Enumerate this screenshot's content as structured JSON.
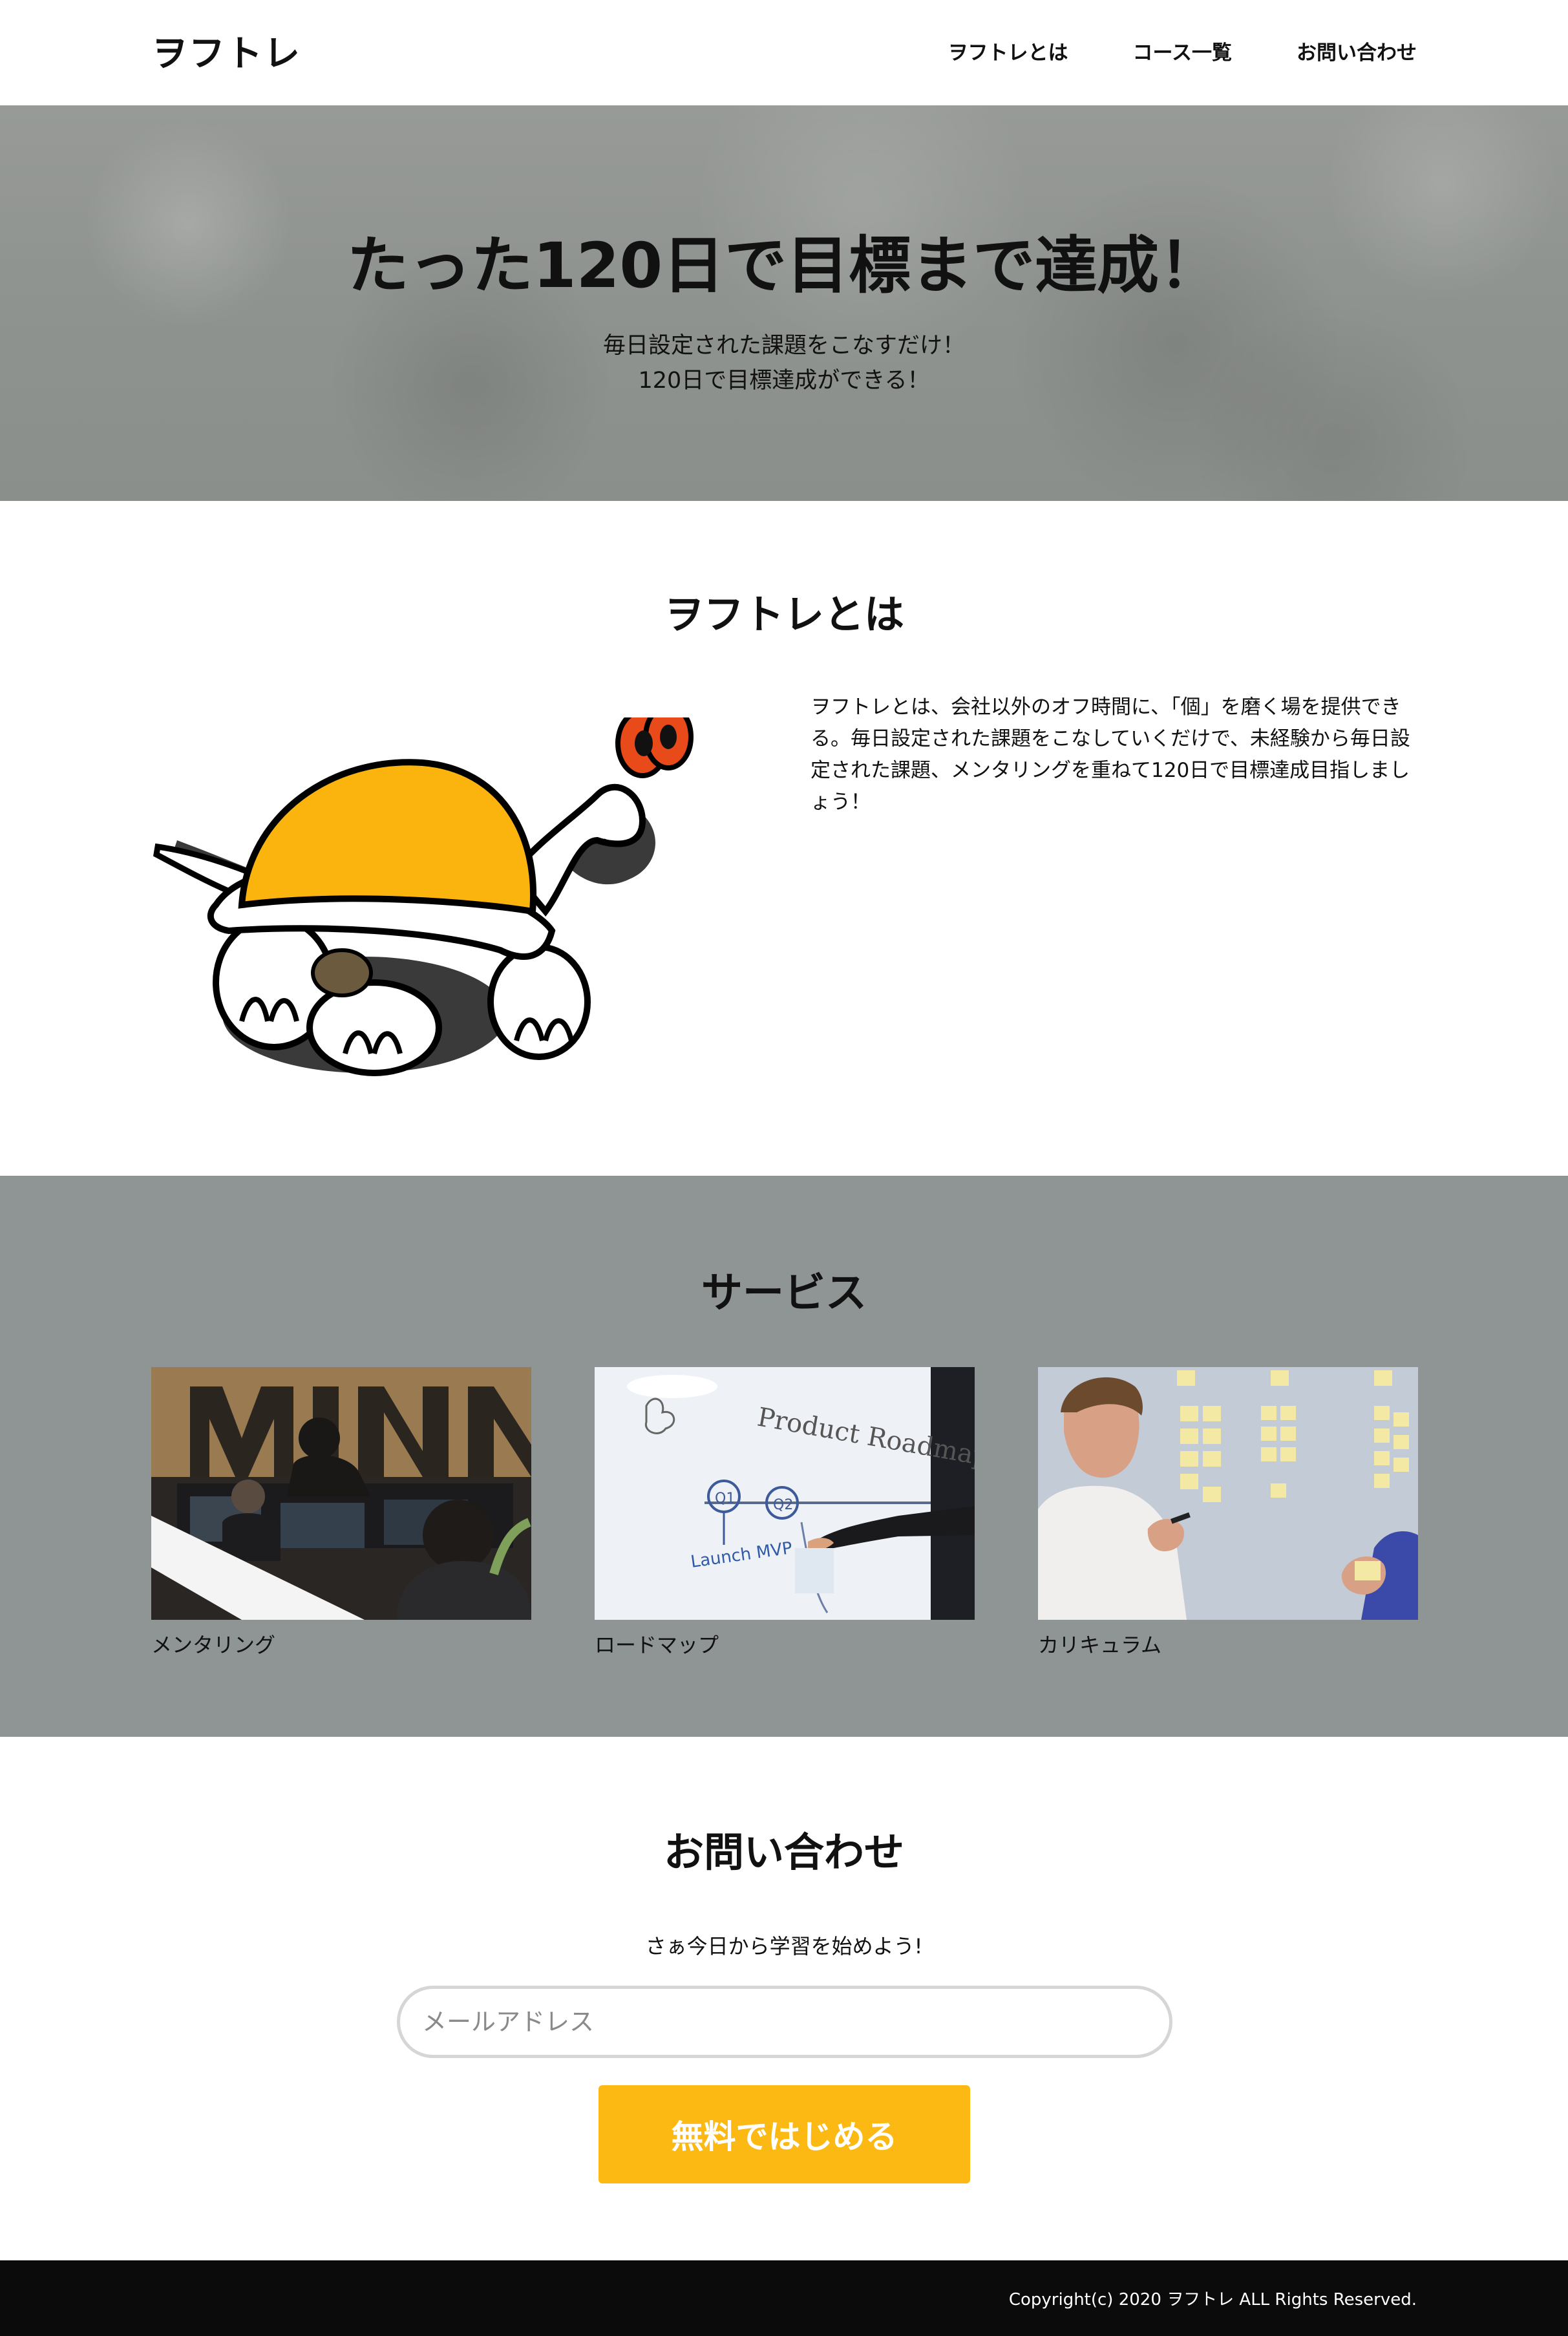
{
  "header": {
    "logo": "ヲフトレ",
    "nav": [
      "ヲフトレとは",
      "コース一覧",
      "お問い合わせ"
    ]
  },
  "hero": {
    "title": "たった120日で目標まで達成！",
    "subtitle_line1": "毎日設定された課題をこなすだけ！",
    "subtitle_line2": "120日で目標達成ができる！"
  },
  "about": {
    "title": "ヲフトレとは",
    "text": "ヲフトレとは、会社以外のオフ時間に、「個」を磨く場を提供できる。毎日設定された課題をこなしていくだけで、未経験から毎日設定された課題、メンタリングを重ねて120日で目標達成目指しましょう！",
    "image_icon": "turtle-illustration"
  },
  "services": {
    "title": "サービス",
    "items": [
      {
        "caption": "メンタリング",
        "image": "mentoring-photo"
      },
      {
        "caption": "ロードマップ",
        "image": "whiteboard-roadmap-photo"
      },
      {
        "caption": "カリキュラム",
        "image": "sticky-notes-curriculum-photo"
      }
    ],
    "whiteboard_heading": "Product Roadmap",
    "whiteboard_q": [
      "Q1",
      "Q2"
    ],
    "whiteboard_note": "Launch MVP"
  },
  "contact": {
    "title": "お問い合わせ",
    "lead": "さぁ今日から学習を始めよう!",
    "email_placeholder": "メールアドレス",
    "email_value": "",
    "cta_label": "無料ではじめる"
  },
  "footer": {
    "copyright": "Copyright(c) 2020 ヲフトレ ALL Rights Reserved."
  },
  "colors": {
    "accent": "#fdb913",
    "services_bg": "#8f9595",
    "footer_bg": "#0b0b0b"
  }
}
